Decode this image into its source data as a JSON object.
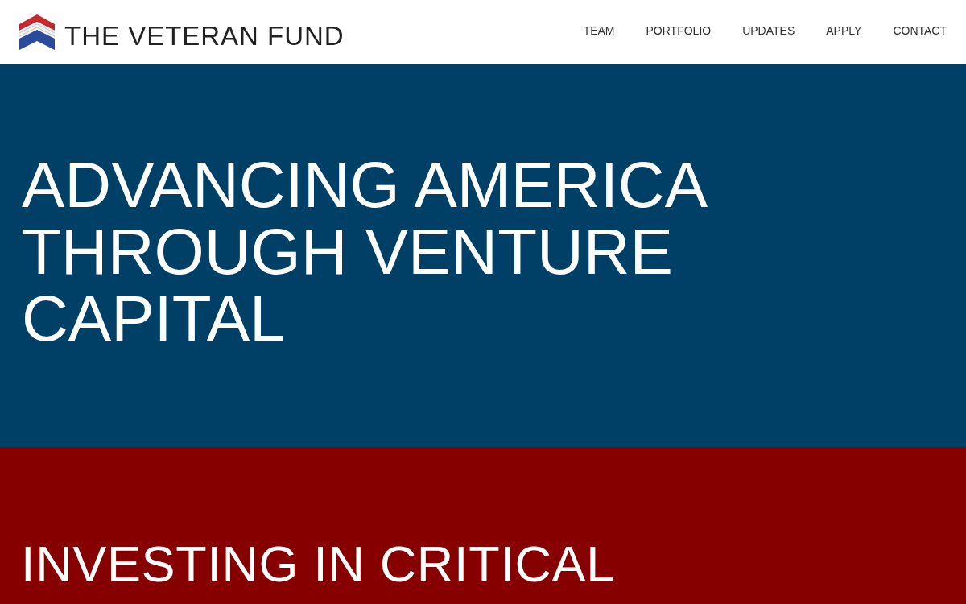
{
  "header": {
    "logo_text": "THE VETERAN FUND",
    "nav": [
      "TEAM",
      "PORTFOLIO",
      "UPDATES",
      "APPLY",
      "CONTACT"
    ]
  },
  "hero": {
    "heading": "ADVANCING AMERICA THROUGH VENTURE CAPITAL"
  },
  "mission": {
    "heading": "INVESTING IN CRITICAL"
  }
}
